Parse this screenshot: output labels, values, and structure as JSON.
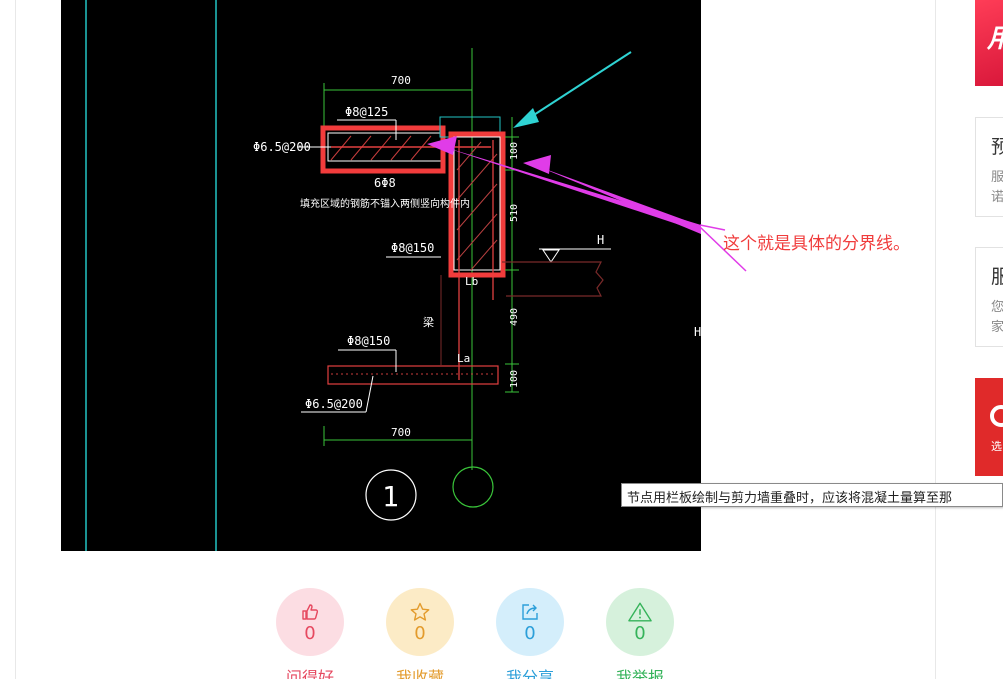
{
  "cad_drawing": {
    "dim_top": "700",
    "dim_bottom": "700",
    "rebar_top": "Φ8@125",
    "rebar_left_top": "Φ6.5@200",
    "rebar_6phi8": "6Φ8",
    "note": "填充区域的钢筋不锚入两侧竖向构件内",
    "rebar_mid": "Φ8@150",
    "rebar_lower": "Φ8@150",
    "rebar_left_bottom": "Φ6.5@200",
    "dim_100_top": "100",
    "dim_510": "510",
    "dim_490": "490",
    "dim_100_bottom": "100",
    "label_lb": "Lb",
    "label_la": "La",
    "label_beam": "梁",
    "label_h": "H",
    "label_h2": "H",
    "detail_number": "1"
  },
  "annotation": "这个就是具体的分界线。",
  "tooltip": "节点用栏板绘制与剪力墙重叠时，应该将混凝土量算至那",
  "actions": [
    {
      "icon": "thumbs-up-icon",
      "count": "0",
      "label": "问得好"
    },
    {
      "icon": "star-icon",
      "count": "0",
      "label": "我收藏"
    },
    {
      "icon": "share-icon",
      "count": "0",
      "label": "我分享"
    },
    {
      "icon": "warning-icon",
      "count": "0",
      "label": "我举报"
    }
  ],
  "sidebar": {
    "ad_top_text": "用",
    "card1": {
      "title": "预",
      "line1": "服",
      "line2": "诺"
    },
    "card2": {
      "title": "服",
      "line1": "您",
      "line2": "家"
    },
    "ad_bottom_text": "选"
  },
  "colors": {
    "cad_background": "#000000",
    "highlight_box": "#f23c3c",
    "arrow_cyan": "#2fd3d3",
    "arrow_magenta": "#e03ce8",
    "annotation_text": "#f03c3c"
  }
}
